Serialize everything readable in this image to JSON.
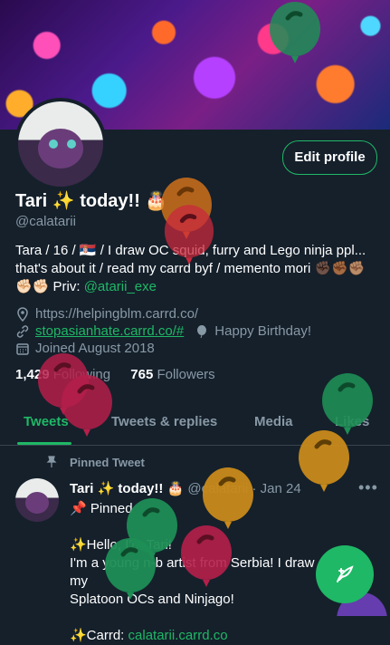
{
  "profile": {
    "display_name": "Tari ✨ today!! 🎂",
    "handle": "@calatarii",
    "edit_button": "Edit profile",
    "bio": {
      "line1": "Tara / 16 / 🇷🇸 / I draw OC squid, furry and Lego ninja ppl...",
      "line2": "that's about it / read my carrd byf / memento mori ✊🏿✊🏾✊🏽",
      "line3_prefix": "✊🏻✊🏻 Priv: ",
      "line3_link": "@atarii_exe"
    },
    "website": "https://helpingblm.carrd.co/",
    "link2": "stopasianhate.carrd.co/#",
    "birthday": "Happy Birthday!",
    "joined": "Joined August 2018",
    "following_count": "1,429",
    "following_label": "Following",
    "followers_count": "765",
    "followers_label": "Followers"
  },
  "tabs": [
    "Tweets",
    "Tweets & replies",
    "Media",
    "Likes"
  ],
  "pinned_tweet": {
    "label": "Pinned Tweet",
    "author": "Tari ✨ today!! 🎂",
    "handle": "@calatarii",
    "date": "· Jan 24",
    "line1": "📌 Pinned",
    "line2": "✨Hello, I'm Tari!",
    "line3": "I'm a young n-b artist from Serbia! I draw a lot of my",
    "line4": "Splatoon OCs and Ninjago!",
    "line5_prefix": "✨Carrd: ",
    "line5_link": "calatarii.carrd.co"
  },
  "colors": {
    "accent": "#1fb866",
    "background": "#15202b",
    "muted": "#8899a6"
  },
  "icons": [
    "location-icon",
    "link-icon",
    "balloon-icon",
    "calendar-icon",
    "pin-icon",
    "more-icon",
    "compose-icon"
  ]
}
